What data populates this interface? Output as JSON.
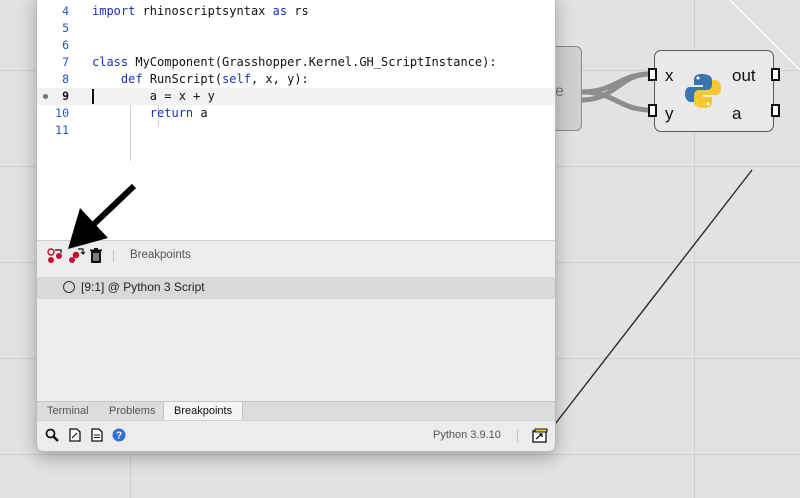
{
  "editor": {
    "code_lines": [
      {
        "num": "4",
        "text": "import rhinoscriptsyntax as rs"
      },
      {
        "num": "5",
        "text": ""
      },
      {
        "num": "6",
        "text": ""
      },
      {
        "num": "7",
        "text": "class MyComponent(Grasshopper.Kernel.GH_ScriptInstance):"
      },
      {
        "num": "8",
        "text": "    def RunScript(self, x, y):"
      },
      {
        "num": "9",
        "text": "        a = x + y"
      },
      {
        "num": "10",
        "text": "        return a"
      },
      {
        "num": "11",
        "text": ""
      }
    ],
    "current_line": "9",
    "breakpoint_line": "9"
  },
  "breakpoints_panel": {
    "title": "Breakpoints",
    "tool_icons": [
      "step-breakpoint-icon",
      "toggle-breakpoint-icon",
      "trash-icon"
    ],
    "items": [
      {
        "label": "[9:1] @ Python 3 Script"
      }
    ]
  },
  "bottom_tabs": [
    "Terminal",
    "Problems",
    "Breakpoints"
  ],
  "active_tab": "Breakpoints",
  "status": {
    "version": "Python 3.9.10",
    "icons": [
      "search-icon",
      "document-icon",
      "document-lines-icon",
      "help-icon",
      "export-icon"
    ]
  },
  "canvas": {
    "left_component_partial_text": "e",
    "python_component": {
      "inputs": [
        "x",
        "y"
      ],
      "outputs": [
        "out",
        "a"
      ]
    }
  },
  "colors": {
    "keyword": "#1a32b8",
    "line_number": "#2255c4",
    "canvas": "#e2e2e2"
  }
}
